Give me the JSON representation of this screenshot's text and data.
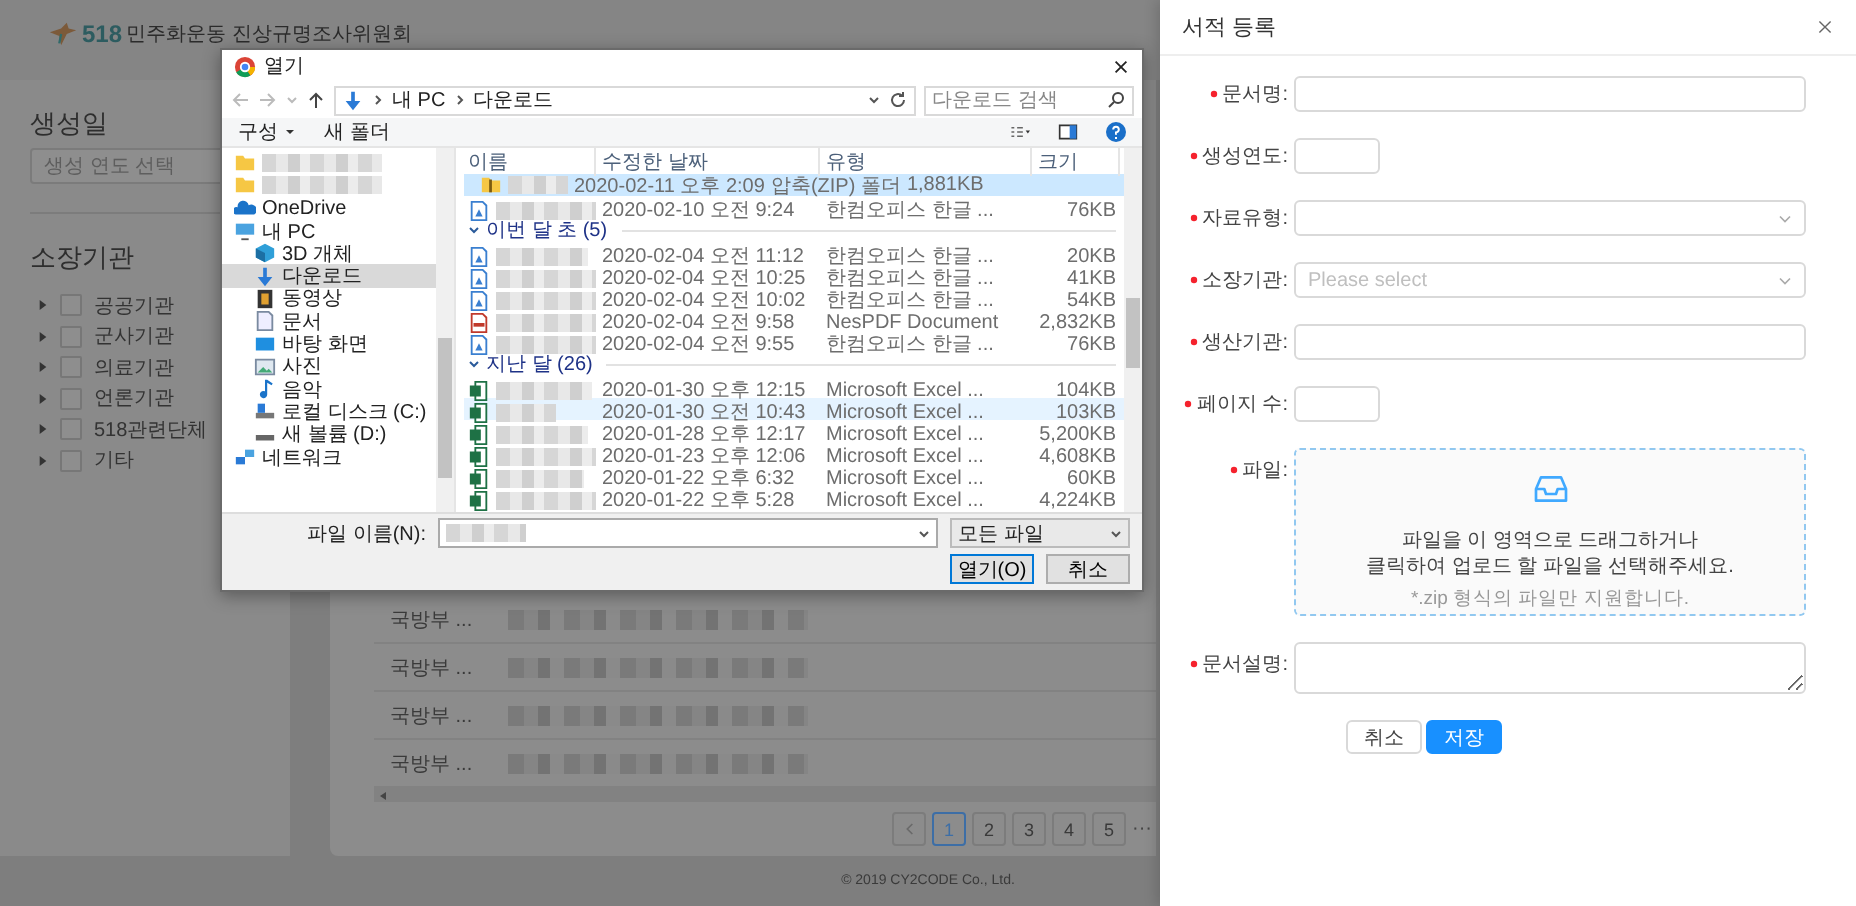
{
  "header": {
    "logo_number": "518",
    "logo_name": "민주화운동 진상규명조사위원회"
  },
  "sidebar": {
    "date_heading": "생성일",
    "date_placeholder": "생성 연도 선택",
    "org_heading": "소장기관",
    "orgs": [
      {
        "label": "공공기관",
        "checked": false
      },
      {
        "label": "군사기관",
        "checked": false
      },
      {
        "label": "의료기관",
        "checked": false
      },
      {
        "label": "언론기관",
        "checked": false
      },
      {
        "label": "518관련단체",
        "checked": false
      },
      {
        "label": "기타",
        "checked": false
      }
    ]
  },
  "table": {
    "rows": [
      {
        "agency": "국방부 ..."
      },
      {
        "agency": "국방부 ..."
      },
      {
        "agency": "국방부 ..."
      },
      {
        "agency": "국방부 ..."
      }
    ]
  },
  "pagination": {
    "pages": [
      {
        "label": "1",
        "selected": true
      },
      {
        "label": "2",
        "selected": false
      },
      {
        "label": "3",
        "selected": false
      },
      {
        "label": "4",
        "selected": false
      },
      {
        "label": "5",
        "selected": false
      }
    ],
    "more": "···"
  },
  "footer": "© 2019 CY2CODE Co., Ltd.",
  "file_dialog": {
    "title": "열기",
    "breadcrumb": [
      "내 PC",
      "다운로드"
    ],
    "search_placeholder": "다운로드 검색",
    "toolbar": [
      "구성",
      "새 폴더"
    ],
    "nav": [
      {
        "kind": "folder",
        "selected": false
      },
      {
        "kind": "folder",
        "selected": false
      },
      {
        "label": "OneDrive",
        "kind": "cloud",
        "selected": false
      },
      {
        "label": "내 PC",
        "kind": "pc",
        "selected": false,
        "children": [
          {
            "label": "3D 개체",
            "kind": "cube",
            "selected": false
          },
          {
            "label": "다운로드",
            "kind": "download",
            "selected": true
          },
          {
            "label": "동영상",
            "kind": "video",
            "selected": false
          },
          {
            "label": "문서",
            "kind": "document",
            "selected": false
          },
          {
            "label": "바탕 화면",
            "kind": "desktop",
            "selected": false
          },
          {
            "label": "사진",
            "kind": "picture",
            "selected": false
          },
          {
            "label": "음악",
            "kind": "music",
            "selected": false
          },
          {
            "label": "로컬 디스크 (C:)",
            "kind": "disk",
            "selected": false
          },
          {
            "label": "새 볼륨 (D:)",
            "kind": "drive",
            "selected": false
          }
        ]
      },
      {
        "label": "네트워크",
        "kind": "network",
        "selected": false
      }
    ],
    "columns": [
      "이름",
      "수정한 날짜",
      "유형",
      "크기"
    ],
    "groups": [
      {
        "rows": [
          {
            "kind": "zip",
            "modified": "2020-02-11 오후 2:09",
            "type": "압축(ZIP) 폴더",
            "size": "1,881KB",
            "selected": true,
            "hovered": false
          },
          {
            "kind": "hwp",
            "modified": "2020-02-10 오전 9:24",
            "type": "한컴오피스 한글 ...",
            "size": "76KB",
            "selected": false,
            "hovered": false
          }
        ]
      },
      {
        "title": "이번 달 초 (5)",
        "rows": [
          {
            "kind": "hwp",
            "modified": "2020-02-04 오전 11:12",
            "type": "한컴오피스 한글 ...",
            "size": "20KB",
            "selected": false,
            "hovered": false
          },
          {
            "kind": "hwp",
            "modified": "2020-02-04 오전 10:25",
            "type": "한컴오피스 한글 ...",
            "size": "41KB",
            "selected": false,
            "hovered": false
          },
          {
            "kind": "hwp",
            "modified": "2020-02-04 오전 10:02",
            "type": "한컴오피스 한글 ...",
            "size": "54KB",
            "selected": false,
            "hovered": false
          },
          {
            "kind": "pdf",
            "modified": "2020-02-04 오전 9:58",
            "type": "NesPDF Document",
            "size": "2,832KB",
            "selected": false,
            "hovered": false
          },
          {
            "kind": "hwp",
            "modified": "2020-02-04 오전 9:55",
            "type": "한컴오피스 한글 ...",
            "size": "76KB",
            "selected": false,
            "hovered": false
          }
        ]
      },
      {
        "title": "지난 달 (26)",
        "rows": [
          {
            "kind": "excel",
            "modified": "2020-01-30 오후 12:15",
            "type": "Microsoft Excel ...",
            "size": "104KB",
            "selected": false,
            "hovered": false
          },
          {
            "kind": "excel",
            "modified": "2020-01-30 오전 10:43",
            "type": "Microsoft Excel ...",
            "size": "103KB",
            "selected": false,
            "hovered": true
          },
          {
            "kind": "excel",
            "modified": "2020-01-28 오후 12:17",
            "type": "Microsoft Excel ...",
            "size": "5,200KB",
            "selected": false,
            "hovered": false
          },
          {
            "kind": "excel",
            "modified": "2020-01-23 오후 12:06",
            "type": "Microsoft Excel ...",
            "size": "4,608KB",
            "selected": false,
            "hovered": false
          },
          {
            "kind": "excel",
            "modified": "2020-01-22 오후 6:32",
            "type": "Microsoft Excel ...",
            "size": "60KB",
            "selected": false,
            "hovered": false
          },
          {
            "kind": "excel",
            "modified": "2020-01-22 오후 5:28",
            "type": "Microsoft Excel ...",
            "size": "4,224KB",
            "selected": false,
            "hovered": false
          }
        ]
      }
    ],
    "filename_label": "파일 이름(N):",
    "file_type": "모든 파일",
    "open_button": "열기(O)",
    "cancel_button": "취소"
  },
  "drawer": {
    "title": "서적 등록",
    "fields": [
      {
        "label": "문서명:",
        "kind": "text",
        "required": true
      },
      {
        "label": "생성연도:",
        "kind": "short",
        "required": true
      },
      {
        "label": "자료유형:",
        "kind": "select",
        "required": true
      },
      {
        "label": "소장기관:",
        "kind": "select",
        "required": true,
        "placeholder": "Please select"
      },
      {
        "label": "생산기관:",
        "kind": "text",
        "required": true
      },
      {
        "label": "페이지 수:",
        "kind": "short",
        "required": true
      },
      {
        "label": "파일:",
        "kind": "upload",
        "required": true,
        "lines": [
          "파일을 이 영역으로 드래그하거나",
          "클릭하여 업로드 할 파일을 선택해주세요."
        ],
        "hint": "*.zip 형식의 파일만 지원합니다."
      },
      {
        "label": "문서설명:",
        "kind": "textarea",
        "required": true
      }
    ],
    "buttons": [
      {
        "label": "취소",
        "primary": false
      },
      {
        "label": "저장",
        "primary": true
      }
    ]
  }
}
